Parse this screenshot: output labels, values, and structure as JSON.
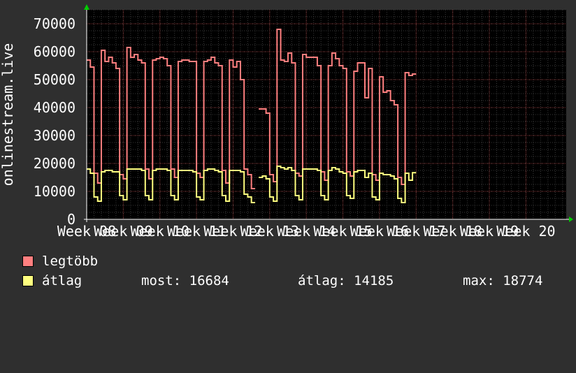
{
  "chart_data": {
    "type": "line",
    "ylabel": "onlinestream.live",
    "ylim": [
      0,
      75000
    ],
    "yticks": [
      0,
      10000,
      20000,
      30000,
      40000,
      50000,
      60000,
      70000
    ],
    "ytick_labels": [
      "0",
      "10000",
      "20000",
      "30000",
      "40000",
      "50000",
      "60000",
      "70000"
    ],
    "xlim": [
      0,
      131
    ],
    "week_ticks": [
      {
        "x": 0,
        "label": "Week 08"
      },
      {
        "x": 10,
        "label": "Week 09"
      },
      {
        "x": 20,
        "label": "Week 10"
      },
      {
        "x": 30,
        "label": "Week 11"
      },
      {
        "x": 40,
        "label": "Week 12"
      },
      {
        "x": 50,
        "label": "Week 13"
      },
      {
        "x": 60,
        "label": "Week 14"
      },
      {
        "x": 70,
        "label": "Week 15"
      },
      {
        "x": 80,
        "label": "Week 16"
      },
      {
        "x": 90,
        "label": "Week 17"
      },
      {
        "x": 100,
        "label": "Week 18"
      },
      {
        "x": 110,
        "label": "Week 19"
      },
      {
        "x": 120,
        "label": "Week 20"
      }
    ],
    "grid": true,
    "series": [
      {
        "name": "legtöbb",
        "color": "#ff7f7f",
        "points": [
          [
            0,
            57000
          ],
          [
            1,
            54500
          ],
          [
            2,
            16500
          ],
          [
            3,
            13000
          ],
          [
            4,
            60500
          ],
          [
            5,
            56500
          ],
          [
            6,
            58000
          ],
          [
            7,
            56000
          ],
          [
            8,
            54000
          ],
          [
            9,
            16000
          ],
          [
            10,
            14500
          ],
          [
            11,
            61500
          ],
          [
            12,
            58000
          ],
          [
            13,
            59000
          ],
          [
            14,
            57000
          ],
          [
            15,
            56000
          ],
          [
            16,
            18000
          ],
          [
            17,
            14500
          ],
          [
            18,
            57000
          ],
          [
            19,
            57500
          ],
          [
            20,
            58000
          ],
          [
            21,
            57500
          ],
          [
            22,
            55000
          ],
          [
            23,
            18000
          ],
          [
            24,
            15000
          ],
          [
            25,
            56500
          ],
          [
            26,
            57000
          ],
          [
            27,
            57000
          ],
          [
            28,
            56500
          ],
          [
            29,
            56500
          ],
          [
            30,
            16500
          ],
          [
            31,
            15000
          ],
          [
            32,
            56500
          ],
          [
            33,
            57000
          ],
          [
            34,
            58000
          ],
          [
            35,
            56000
          ],
          [
            36,
            55000
          ],
          [
            37,
            17500
          ],
          [
            38,
            13000
          ],
          [
            39,
            57000
          ],
          [
            40,
            54500
          ],
          [
            41,
            56500
          ],
          [
            42,
            50000
          ],
          [
            43,
            18000
          ],
          [
            44,
            16000
          ],
          [
            45,
            11000
          ],
          [
            46,
            null
          ],
          [
            47,
            39500
          ],
          [
            48,
            39500
          ],
          [
            49,
            38000
          ],
          [
            50,
            16000
          ],
          [
            51,
            13500
          ],
          [
            52,
            68000
          ],
          [
            53,
            57000
          ],
          [
            54,
            56500
          ],
          [
            55,
            59500
          ],
          [
            56,
            56000
          ],
          [
            57,
            16500
          ],
          [
            58,
            15500
          ],
          [
            59,
            59000
          ],
          [
            60,
            58000
          ],
          [
            61,
            58000
          ],
          [
            62,
            58000
          ],
          [
            63,
            55000
          ],
          [
            64,
            17000
          ],
          [
            65,
            14000
          ],
          [
            66,
            55000
          ],
          [
            67,
            59500
          ],
          [
            68,
            57500
          ],
          [
            69,
            55000
          ],
          [
            70,
            54000
          ],
          [
            71,
            17000
          ],
          [
            72,
            15500
          ],
          [
            73,
            53000
          ],
          [
            74,
            56000
          ],
          [
            75,
            56000
          ],
          [
            76,
            43500
          ],
          [
            77,
            54000
          ],
          [
            78,
            16000
          ],
          [
            79,
            14000
          ],
          [
            80,
            51000
          ],
          [
            81,
            45500
          ],
          [
            82,
            46000
          ],
          [
            83,
            42500
          ],
          [
            84,
            41000
          ],
          [
            85,
            15000
          ],
          [
            86,
            12500
          ],
          [
            87,
            52500
          ],
          [
            88,
            51500
          ],
          [
            89,
            52000
          ]
        ]
      },
      {
        "name": "átlag",
        "color": "#ffff7f",
        "points": [
          [
            0,
            18000
          ],
          [
            1,
            16500
          ],
          [
            2,
            8000
          ],
          [
            3,
            6500
          ],
          [
            4,
            17000
          ],
          [
            5,
            17500
          ],
          [
            6,
            17500
          ],
          [
            7,
            17000
          ],
          [
            8,
            17000
          ],
          [
            9,
            8500
          ],
          [
            10,
            7000
          ],
          [
            11,
            18000
          ],
          [
            12,
            18000
          ],
          [
            13,
            18000
          ],
          [
            14,
            18000
          ],
          [
            15,
            17500
          ],
          [
            16,
            8500
          ],
          [
            17,
            7000
          ],
          [
            18,
            17500
          ],
          [
            19,
            18000
          ],
          [
            20,
            18000
          ],
          [
            21,
            18000
          ],
          [
            22,
            17500
          ],
          [
            23,
            8500
          ],
          [
            24,
            7000
          ],
          [
            25,
            17500
          ],
          [
            26,
            17500
          ],
          [
            27,
            17500
          ],
          [
            28,
            17500
          ],
          [
            29,
            17000
          ],
          [
            30,
            8000
          ],
          [
            31,
            7000
          ],
          [
            32,
            17500
          ],
          [
            33,
            18000
          ],
          [
            34,
            18000
          ],
          [
            35,
            17500
          ],
          [
            36,
            17000
          ],
          [
            37,
            8500
          ],
          [
            38,
            6500
          ],
          [
            39,
            17500
          ],
          [
            40,
            17500
          ],
          [
            41,
            17500
          ],
          [
            42,
            17000
          ],
          [
            43,
            9000
          ],
          [
            44,
            8000
          ],
          [
            45,
            6000
          ],
          [
            46,
            null
          ],
          [
            47,
            15000
          ],
          [
            48,
            15500
          ],
          [
            49,
            14500
          ],
          [
            50,
            8000
          ],
          [
            51,
            6500
          ],
          [
            52,
            19000
          ],
          [
            53,
            18500
          ],
          [
            54,
            18000
          ],
          [
            55,
            18500
          ],
          [
            56,
            17500
          ],
          [
            57,
            8500
          ],
          [
            58,
            7000
          ],
          [
            59,
            18000
          ],
          [
            60,
            18000
          ],
          [
            61,
            18000
          ],
          [
            62,
            18000
          ],
          [
            63,
            17500
          ],
          [
            64,
            8500
          ],
          [
            65,
            7000
          ],
          [
            66,
            17500
          ],
          [
            67,
            18500
          ],
          [
            68,
            18000
          ],
          [
            69,
            17000
          ],
          [
            70,
            16500
          ],
          [
            71,
            8500
          ],
          [
            72,
            7500
          ],
          [
            73,
            17000
          ],
          [
            74,
            17500
          ],
          [
            75,
            17500
          ],
          [
            76,
            15000
          ],
          [
            77,
            16500
          ],
          [
            78,
            8000
          ],
          [
            79,
            7000
          ],
          [
            80,
            16500
          ],
          [
            81,
            16000
          ],
          [
            82,
            16000
          ],
          [
            83,
            15500
          ],
          [
            84,
            14500
          ],
          [
            85,
            7500
          ],
          [
            86,
            6000
          ],
          [
            87,
            16500
          ],
          [
            88,
            14000
          ],
          [
            89,
            16684
          ]
        ]
      }
    ]
  },
  "legend": {
    "max_label": "legtöbb",
    "avg_label": "átlag",
    "stats": {
      "most": "most: 16684",
      "atlag": "átlag: 14185",
      "max": "max: 18774"
    }
  },
  "colors": {
    "background": "#2f2f2f",
    "plot_bg": "#000000",
    "grid_minor": "#3a3a3a",
    "grid_major": "#7a2a2a",
    "axis": "#ffffff",
    "arrow": "#00cc00"
  }
}
